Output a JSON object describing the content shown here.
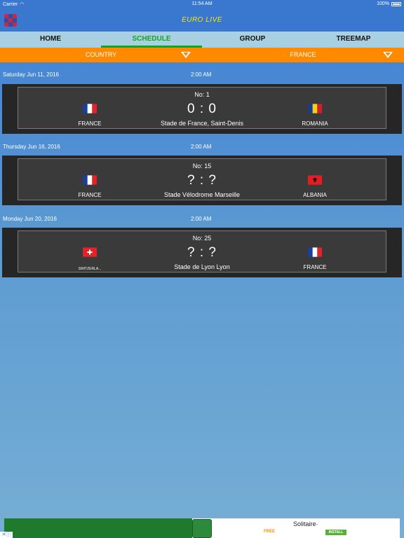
{
  "status_bar": {
    "carrier": "Carrier",
    "wifi_icon": "wifi-icon",
    "time": "11:54 AM",
    "battery": "100%"
  },
  "header": {
    "title": "EURO LIVE",
    "logo_icon": "app-logo-icon"
  },
  "tabs": [
    {
      "label": "HOME",
      "active": false
    },
    {
      "label": "SCHEDULE",
      "active": true
    },
    {
      "label": "GROUP",
      "active": false
    },
    {
      "label": "TREEMAP",
      "active": false
    }
  ],
  "filters": {
    "country_label": "COUNTRY",
    "country_value": "FRANCE"
  },
  "matches": [
    {
      "date": "Saturday Jun 11, 2016",
      "time": "2:00 AM",
      "no": "No: 1",
      "score": "0 : 0",
      "venue": "Stade de France, Saint-Denis",
      "home": "FRANCE",
      "away": "ROMANIA",
      "home_flag": "france-flag-icon",
      "away_flag": "romania-flag-icon"
    },
    {
      "date": "Thursday Jun 16, 2016",
      "time": "2:00 AM",
      "no": "No: 15",
      "score": "? : ?",
      "venue": "Stade Vélodrome Marseille",
      "home": "FRANCE",
      "away": "ALBANIA",
      "home_flag": "france-flag-icon",
      "away_flag": "albania-flag-icon"
    },
    {
      "date": "Monday Jun 20, 2016",
      "time": "2:00 AM",
      "no": "No: 25",
      "score": "? : ?",
      "venue": "Stade de Lyon Lyon",
      "home": "SWITZERLA...",
      "away": "FRANCE",
      "home_flag": "switzerland-flag-icon",
      "away_flag": "france-flag-icon"
    }
  ],
  "ad": {
    "title": "Solitaire·",
    "price": "FREE",
    "install": "INSTALL",
    "close": "✕ⓘ"
  },
  "colors": {
    "primary": "#3a78cf",
    "accent_orange": "#ff8a00",
    "active_tab": "#14a51a",
    "title": "#ffe600"
  }
}
